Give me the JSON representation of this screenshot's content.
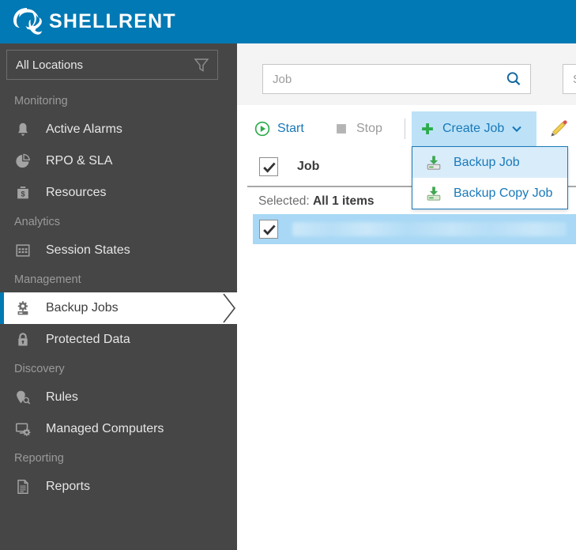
{
  "brand": {
    "name": "SHELLRENT",
    "logo_icon": "shell-spiral-logo",
    "bar_color": "#0079b4"
  },
  "sidebar": {
    "location_filter": {
      "value": "All Locations",
      "filter_icon": "funnel-icon"
    },
    "groups": [
      {
        "label": "Monitoring",
        "items": [
          {
            "label": "Active Alarms",
            "icon": "bell-icon",
            "active": false
          },
          {
            "label": "RPO & SLA",
            "icon": "pie-chart-icon",
            "active": false
          },
          {
            "label": "Resources",
            "icon": "money-bag-icon",
            "active": false
          }
        ]
      },
      {
        "label": "Analytics",
        "items": [
          {
            "label": "Session States",
            "icon": "grid-table-icon",
            "active": false
          }
        ]
      },
      {
        "label": "Management",
        "items": [
          {
            "label": "Backup Jobs",
            "icon": "gear-drive-icon",
            "active": true
          },
          {
            "label": "Protected Data",
            "icon": "lock-icon",
            "active": false
          }
        ]
      },
      {
        "label": "Discovery",
        "items": [
          {
            "label": "Rules",
            "icon": "pin-search-icon",
            "active": false
          },
          {
            "label": "Managed Computers",
            "icon": "monitor-gear-icon",
            "active": false
          }
        ]
      },
      {
        "label": "Reporting",
        "items": [
          {
            "label": "Reports",
            "icon": "document-icon",
            "active": false
          }
        ]
      }
    ],
    "background_color": "#464646",
    "active_accent_color": "#0079b4"
  },
  "main": {
    "search_primary": {
      "value": "",
      "placeholder": "Job",
      "icon": "search-icon"
    },
    "search_secondary": {
      "value": "",
      "placeholder": "S",
      "icon": "search-icon"
    },
    "toolbar": {
      "start": {
        "label": "Start",
        "icon": "play-circle-icon",
        "enabled": true
      },
      "stop": {
        "label": "Stop",
        "icon": "stop-square-icon",
        "enabled": false
      },
      "create_job": {
        "label": "Create Job",
        "icon": "plus-icon",
        "chevron": "chevron-down-icon",
        "highlight_color": "#bde2f7",
        "expanded": true
      },
      "edit": {
        "label": "",
        "icon": "pencil-edit-icon"
      }
    },
    "dropdown": {
      "border_color": "#1879b9",
      "items": [
        {
          "label": "Backup Job",
          "icon": "backup-job-icon",
          "highlighted": true
        },
        {
          "label": "Backup Copy Job",
          "icon": "backup-copy-job-icon",
          "highlighted": false
        }
      ]
    },
    "table": {
      "select_all_checked": true,
      "column_header": "Job",
      "selection_prefix": "Selected:",
      "selection_count": "All 1 items",
      "rows": [
        {
          "checked": true,
          "name": "",
          "redacted": true,
          "row_color": "#a8d8f5"
        }
      ]
    }
  }
}
